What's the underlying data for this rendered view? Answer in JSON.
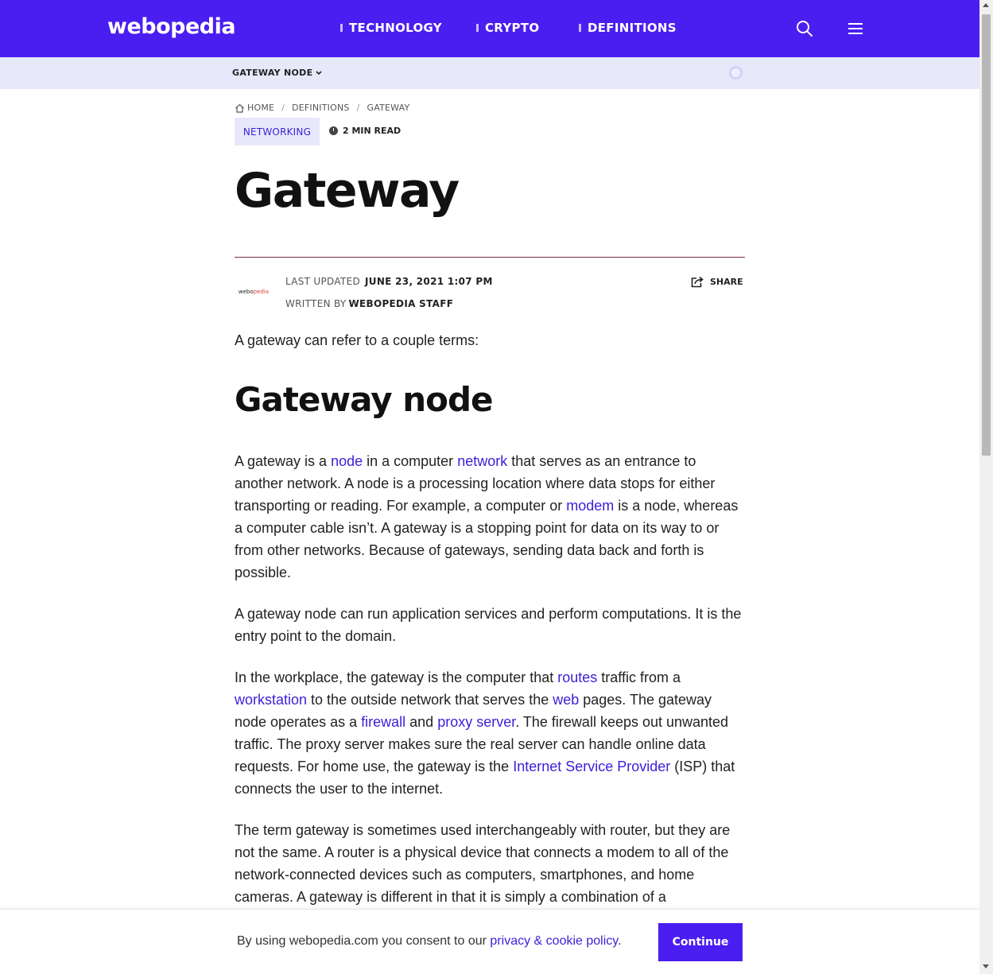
{
  "header": {
    "logo": "webopedia",
    "nav": [
      "TECHNOLOGY",
      "CRYPTO",
      "DEFINITIONS"
    ],
    "search_icon": "search-icon",
    "menu_icon": "hamburger-menu-icon",
    "accent": "#4a1ef0"
  },
  "subnav": {
    "title": "GATEWAY NODE"
  },
  "breadcrumb": [
    "HOME",
    "DEFINITIONS",
    "GATEWAY"
  ],
  "article": {
    "tag": "NETWORKING",
    "read_time": "2 MIN READ",
    "title": "Gateway",
    "last_updated_label": "LAST UPDATED",
    "last_updated": "JUNE 23, 2021 1:07 PM",
    "written_by_label": "WRITTEN BY",
    "author": "WEBOPEDIA STAFF",
    "author_logo_a": "webo",
    "author_logo_b": "pedia",
    "share": "SHARE",
    "intro": "A gateway can refer to a couple terms:",
    "subheading": "Gateway node",
    "p1": {
      "t1": "A gateway is a ",
      "l1": "node",
      "t2": " in a computer ",
      "l2": "network",
      "t3": " that serves as an entrance to another network. A node is a processing location where data stops for either transporting or reading. For example, a computer or ",
      "l3": "modem",
      "t4": " is a node, whereas a computer cable isn’t. A gateway is a stopping point for data on its way to or from other networks. Because of gateways, sending data back and forth is possible."
    },
    "p2": "A gateway node can run application services and perform computations. It is the entry point to the domain.",
    "p3": {
      "t1": "In the workplace, the gateway is the computer that ",
      "l1": "routes",
      "t2": " traffic from a ",
      "l2": "workstation",
      "t3": " to the outside network that serves the ",
      "l3": "web",
      "t4": " pages. The gateway node operates as a ",
      "l4": "firewall",
      "t5": " and ",
      "l5": "proxy server",
      "t6": ". The firewall keeps out unwanted traffic. The proxy server makes sure the real server can handle online data requests. For home use, the gateway is the ",
      "l6": "Internet Service Provider",
      "t7": " (ISP) that connects the user to the internet."
    },
    "p4": "The term gateway is sometimes used interchangeably with router, but they are not the same. A router is a physical device that connects a modem to all of the network-connected devices such as computers, smartphones, and home cameras. A gateway is different in that it is simply a combination of a"
  },
  "consent": {
    "text": "By using webopedia.com you consent to our ",
    "link": "privacy & cookie policy",
    "period": ".",
    "button": "Continue"
  }
}
